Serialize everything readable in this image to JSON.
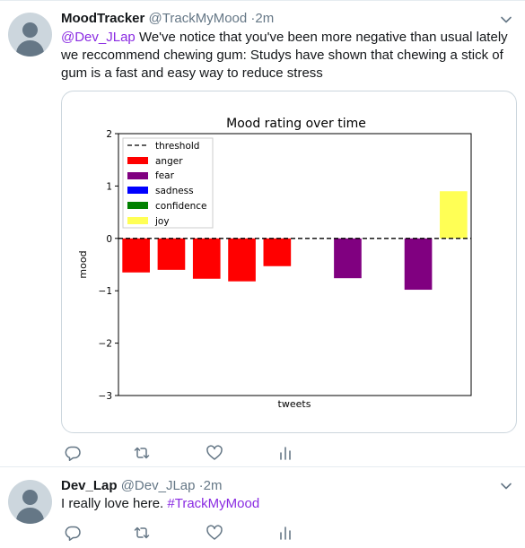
{
  "tweets": [
    {
      "name": "MoodTracker",
      "handle": "@TrackMyMood",
      "separator": "·",
      "time": "2m",
      "mention": "@Dev_JLap",
      "text": " We've notice that you've been more negative than usual lately we reccommend chewing gum: Studys have shown that chewing a stick of gum is a fast and easy way to reduce stress"
    },
    {
      "name": "Dev_Lap",
      "handle": "@Dev_JLap",
      "separator": "·",
      "time": "2m",
      "text": "I really love here. ",
      "hashtag": "#TrackMyMood"
    }
  ],
  "icons": {
    "avatar": "avatar-placeholder",
    "menu": "chevron-down-icon",
    "reply": "reply-icon",
    "retweet": "retweet-icon",
    "like": "heart-icon",
    "analytics": "analytics-icon"
  },
  "colors": {
    "link": "#8a2be2",
    "muted": "#657786",
    "anger": "#ff0000",
    "fear": "#800080",
    "sadness": "#0000ff",
    "confidence": "#008000",
    "joy": "#ffff55"
  },
  "chart_data": {
    "type": "bar",
    "title": "Mood rating over time",
    "xlabel": "tweets",
    "ylabel": "mood",
    "ylim": [
      -3,
      2
    ],
    "yticks": [
      "2",
      "1",
      "0",
      "−1",
      "−2",
      "−3"
    ],
    "grid": false,
    "legend_position": "top-left",
    "threshold": {
      "name": "threshold",
      "value": 0,
      "style": "dashed"
    },
    "legend": [
      "threshold",
      "anger",
      "fear",
      "sadness",
      "confidence",
      "joy"
    ],
    "x": [
      1,
      2,
      3,
      4,
      5,
      6,
      7,
      8,
      9,
      10
    ],
    "series": [
      {
        "name": "anger",
        "color": "#ff0000",
        "values": [
          -0.65,
          -0.6,
          -0.77,
          -0.82,
          -0.53,
          null,
          null,
          null,
          null,
          null
        ]
      },
      {
        "name": "fear",
        "color": "#800080",
        "values": [
          null,
          null,
          null,
          null,
          null,
          null,
          -0.76,
          null,
          -0.98,
          null
        ]
      },
      {
        "name": "sadness",
        "color": "#0000ff",
        "values": [
          null,
          null,
          null,
          null,
          null,
          null,
          null,
          null,
          null,
          null
        ]
      },
      {
        "name": "confidence",
        "color": "#008000",
        "values": [
          null,
          null,
          null,
          null,
          null,
          null,
          null,
          null,
          null,
          null
        ]
      },
      {
        "name": "joy",
        "color": "#ffff55",
        "values": [
          null,
          null,
          null,
          null,
          null,
          null,
          null,
          null,
          null,
          0.9
        ]
      }
    ]
  }
}
